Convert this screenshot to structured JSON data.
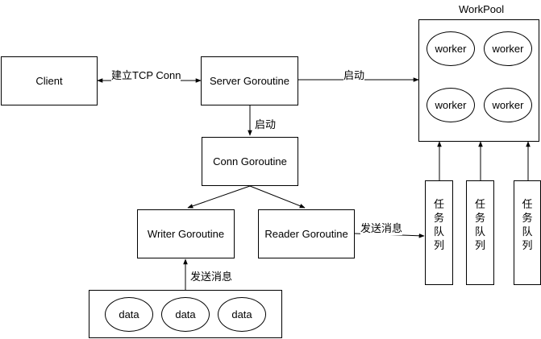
{
  "nodes": {
    "client": "Client",
    "server": "Server Goroutine",
    "conn": "Conn Goroutine",
    "writer": "Writer Goroutine",
    "reader": "Reader Goroutine",
    "workpool_title": "WorkPool",
    "workers": [
      "worker",
      "worker",
      "worker",
      "worker"
    ],
    "data_items": [
      "data",
      "data",
      "data"
    ],
    "task_queues": [
      [
        "任",
        "务",
        "队",
        "列"
      ],
      [
        "任",
        "务",
        "队",
        "列"
      ],
      [
        "任",
        "务",
        "队",
        "列"
      ]
    ]
  },
  "edges": {
    "client_server": "建立TCP Conn",
    "server_workpool": "启动",
    "server_conn": "启动",
    "reader_queue": "发送消息",
    "data_writer": "发送消息"
  }
}
